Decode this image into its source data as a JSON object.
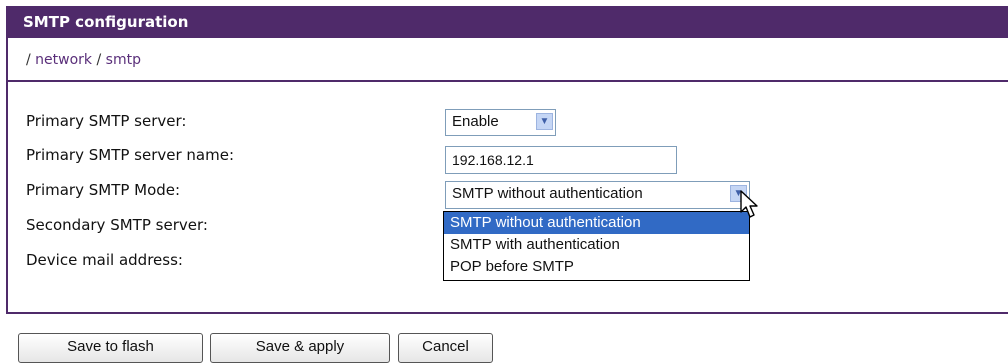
{
  "header": {
    "title": "SMTP configuration"
  },
  "breadcrumb": {
    "sep1": "/",
    "network": "network",
    "sep2": "/",
    "smtp": "smtp"
  },
  "form": {
    "primary_smtp_server": {
      "label": "Primary SMTP server:",
      "value": "Enable"
    },
    "primary_smtp_server_name": {
      "label": "Primary SMTP server name:",
      "value": "192.168.12.1"
    },
    "primary_smtp_mode": {
      "label": "Primary SMTP Mode:",
      "value": "SMTP without authentication",
      "options": [
        "SMTP without authentication",
        "SMTP with authentication",
        "POP before SMTP"
      ]
    },
    "secondary_smtp_server": {
      "label": "Secondary SMTP server:"
    },
    "device_mail_address": {
      "label": "Device mail address:"
    }
  },
  "buttons": {
    "save_flash": "Save to flash",
    "save_apply": "Save & apply",
    "cancel": "Cancel"
  },
  "colors": {
    "accent": "#4f2a6a",
    "selection": "#316ac5",
    "link": "#5a2f7a"
  },
  "icons": {
    "dropdown_arrow": "chevron-down-icon",
    "cursor": "mouse-pointer-icon"
  }
}
